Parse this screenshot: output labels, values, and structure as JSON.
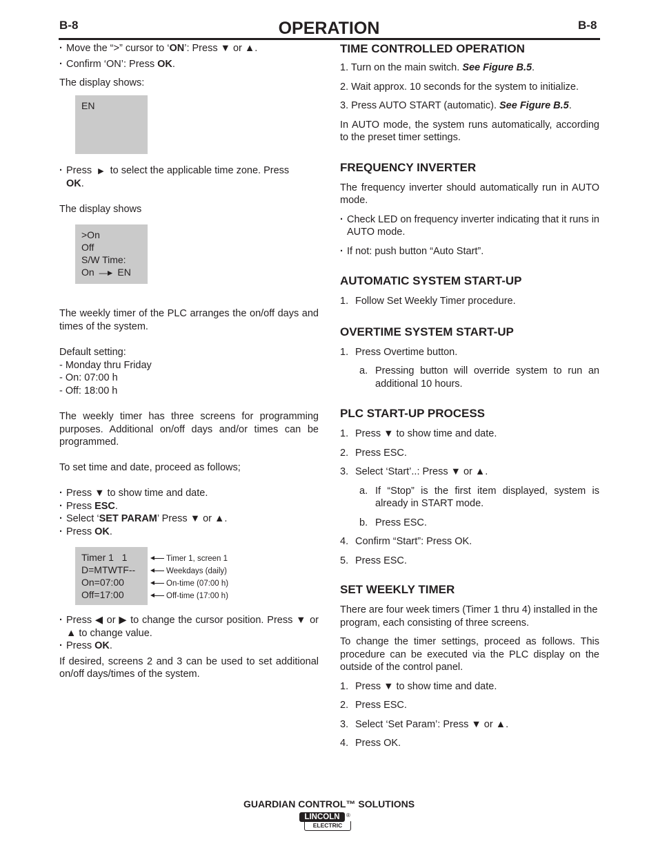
{
  "header": {
    "page_left": "B-8",
    "page_right": "B-8",
    "title": "OPERATION"
  },
  "left": {
    "b1_a": "Move the “>” cursor to ‘",
    "b1_bold": "ON",
    "b1_b": "’: Press ▼ or ▲.",
    "b2_a": "Confirm ‘ON’: Press ",
    "b2_bold": "OK",
    "b2_b": ".",
    "display_shows_1": "The display shows:",
    "lcd1": [
      "EN"
    ],
    "b3_a": "Press",
    "b3_icon": "▶",
    "b3_b": "to select the applicable time zone.  Press",
    "b3_bold": "OK",
    "b3_c": ".",
    "display_shows_2": "The display shows",
    "lcd2": [
      ">On",
      "Off",
      "S/W Time:",
      "On",
      "EN"
    ],
    "p_weekly": "The weekly timer of the PLC arranges the on/off days and times of the system.",
    "default_label": "Default setting:",
    "default_items": [
      "- Monday thru Friday",
      "- On: 07:00 h",
      "- Off: 18:00 h"
    ],
    "p_screens": "The weekly timer has three screens for programming purposes.  Additional on/off days and/or times can be programmed.",
    "p_proceed": "To set time and date, proceed as follows;",
    "steps": {
      "s1": "Press ▼ to show time and date.",
      "s2_a": "Press ",
      "s2_bold": "ESC",
      "s2_b": ".",
      "s3_a": "Select ‘",
      "s3_bold": "SET PARAM",
      "s3_b": "’ Press ▼ or ▲.",
      "s4_a": "Press ",
      "s4_bold": "OK",
      "s4_b": "."
    },
    "timer_lcd": [
      "Timer 1   1",
      "D=MTWTF--",
      "On=07:00",
      "Off=17:00"
    ],
    "timer_annotations": [
      "Timer 1, screen 1",
      "Weekdays (daily)",
      "On-time (07:00 h)",
      "Off-time (17:00 h)"
    ],
    "b_cursor": "Press ◀ or ▶  to change the cursor position.  Press ▼ or ▲ to change value.",
    "b_ok_a": "Press ",
    "b_ok_bold": "OK",
    "b_ok_b": ".",
    "p_final": "If desired, screens 2 and 3 can be used to set additional on/off days/times of the system."
  },
  "right": {
    "tco": {
      "heading": "TIME CONTROLLED OPERATION",
      "i1_a": "1. Turn on the main switch.  ",
      "i1_ref": "See Figure B.5",
      "i1_b": ".",
      "i2": "2. Wait approx. 10 seconds for the system to initialize.",
      "i3_a": "3. Press AUTO START (automatic).  ",
      "i3_ref": "See Figure B.5",
      "i3_b": ".",
      "p": "In AUTO mode, the system runs automatically, according to the preset timer settings."
    },
    "fi": {
      "heading": "FREQUENCY INVERTER",
      "p": "The frequency inverter should automatically run in AUTO mode.",
      "b1": "Check LED on frequency inverter indicating that it runs in AUTO mode.",
      "b2": "If not: push button “Auto Start”."
    },
    "auto": {
      "heading": "AUTOMATIC SYSTEM START-UP",
      "items": [
        {
          "n": "1.",
          "t": "Follow Set Weekly Timer procedure."
        }
      ]
    },
    "overtime": {
      "heading": "OVERTIME SYSTEM START-UP",
      "items": [
        {
          "n": "1.",
          "t": "Press Overtime button."
        }
      ],
      "sub": [
        {
          "n": "a.",
          "t": "Pressing button will override system to run an additional 10 hours."
        }
      ]
    },
    "plc": {
      "heading": "PLC START-UP PROCESS",
      "items": [
        {
          "n": "1.",
          "t": "Press ▼ to show time and date."
        },
        {
          "n": "2.",
          "t": "Press ESC."
        },
        {
          "n": "3.",
          "t": "Select ‘Start’..: Press ▼ or ▲."
        },
        {
          "n": "4.",
          "t": "Confirm “Start”: Press OK."
        },
        {
          "n": "5.",
          "t": "Press ESC."
        }
      ],
      "sub": [
        {
          "n": "a.",
          "t": "If  “Stop” is the first item displayed, system is already in START mode."
        },
        {
          "n": "b.",
          "t": "Press ESC."
        }
      ]
    },
    "swt": {
      "heading": "SET WEEKLY TIMER",
      "p1": "There are four week timers (Timer 1 thru 4) installed in the program, each consisting of three screens.",
      "p2": "To change the timer settings, proceed as follows. This procedure can be executed via the PLC display on the outside of the control panel.",
      "items": [
        {
          "n": "1.",
          "t": "Press ▼ to show time and date."
        },
        {
          "n": "2.",
          "t": "Press ESC."
        },
        {
          "n": "3.",
          "t": "Select ‘Set Param’: Press ▼ or ▲."
        },
        {
          "n": "4.",
          "t": "Press OK."
        }
      ]
    }
  },
  "footer": {
    "title": "GUARDIAN CONTROL™ SOLUTIONS",
    "logo_top": "LINCOLN",
    "logo_bottom": "ELECTRIC",
    "logo_reg": "®"
  }
}
